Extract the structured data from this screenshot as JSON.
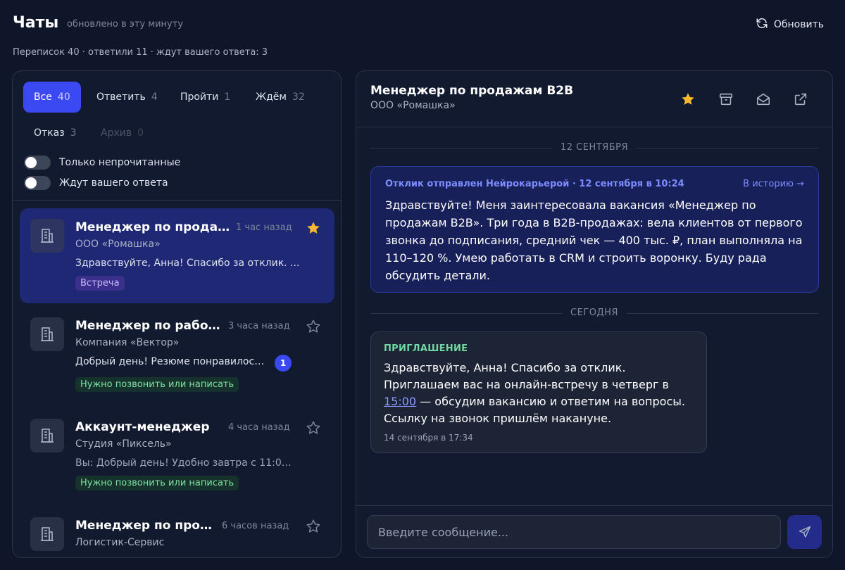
{
  "header": {
    "title": "Чаты",
    "updated": "обновлено в эту минуту",
    "refresh_label": "Обновить",
    "stats": "Переписок 40 · ответили 11 · ждут вашего ответа: 3"
  },
  "tabs": [
    {
      "label": "Все",
      "count": "40",
      "active": true
    },
    {
      "label": "Ответить",
      "count": "4"
    },
    {
      "label": "Пройти",
      "count": "1"
    },
    {
      "label": "Ждём",
      "count": "32"
    },
    {
      "label": "Отказ",
      "count": "3"
    },
    {
      "label": "Архив",
      "count": "0",
      "disabled": true
    }
  ],
  "filters": {
    "unread_label": "Только непрочитанные",
    "awaiting_label": "Ждут вашего ответа"
  },
  "chats": [
    {
      "title": "Менеджер по продажа...",
      "time": "1 час назад",
      "starred": true,
      "company": "ООО «Ромашка»",
      "preview": "Здравствуйте, Анна! Спасибо за отклик. ...",
      "tag": "Встреча"
    },
    {
      "title": "Менеджер по работе ...",
      "time": "3 часа назад",
      "starred": false,
      "company": "Компания «Вектор»",
      "preview": "Добрый день! Резюме понравилось...",
      "unread": "1",
      "tag": "Нужно позвонить или написать"
    },
    {
      "title": "Аккаунт-менеджер",
      "time": "4 часа назад",
      "starred": false,
      "company": "Студия «Пиксель»",
      "preview": "Вы: Добрый день! Удобно завтра с 11:00 ...",
      "tag": "Нужно позвонить или написать"
    },
    {
      "title": "Менеджер по прода...",
      "time": "6 часов назад",
      "starred": false,
      "company": "Логистик-Сервис"
    }
  ],
  "conversation": {
    "title": "Менеджер по продажам B2B",
    "company": "ООО «Ромашка»",
    "date1": "12 СЕНТЯБРЯ",
    "sent_meta": "Отклик отправлен Нейрокарьерой · 12 сентября в 10:24",
    "history_link": "В историю →",
    "sent_text": "Здравствуйте! Меня заинтересовала вакансия «Менеджер по продажам B2B». Три года в B2B-продажах: вела клиентов от первого звонка до подписания, средний чек — 400 тыс. ₽, план выполняла на 110–120 %. Умею работать в CRM и строить воронку. Буду рада обсудить детали.",
    "date2": "СЕГОДНЯ",
    "invite_label": "ПРИГЛАШЕНИЕ",
    "invite_text_1": "Здравствуйте, Анна! Спасибо за отклик. Приглашаем вас на онлайн-встречу в четверг в",
    "invite_time": "15:00",
    "invite_text_2": " — обсудим вакансию и ответим на вопросы. Ссылку на звонок пришлём накануне.",
    "invite_ts": "14 сентября в 17:34"
  },
  "composer": {
    "placeholder": "Введите сообщение..."
  },
  "icons": {
    "refresh": "refresh-icon",
    "star": "star-icon",
    "archive": "archive-icon",
    "mail": "mail-open-icon",
    "external": "external-link-icon",
    "building": "building-icon",
    "send": "send-icon"
  },
  "colors": {
    "accent": "#3a49f2",
    "star": "#f5b82e",
    "invite_label": "#6fd8a0",
    "background": "#0f1629"
  }
}
